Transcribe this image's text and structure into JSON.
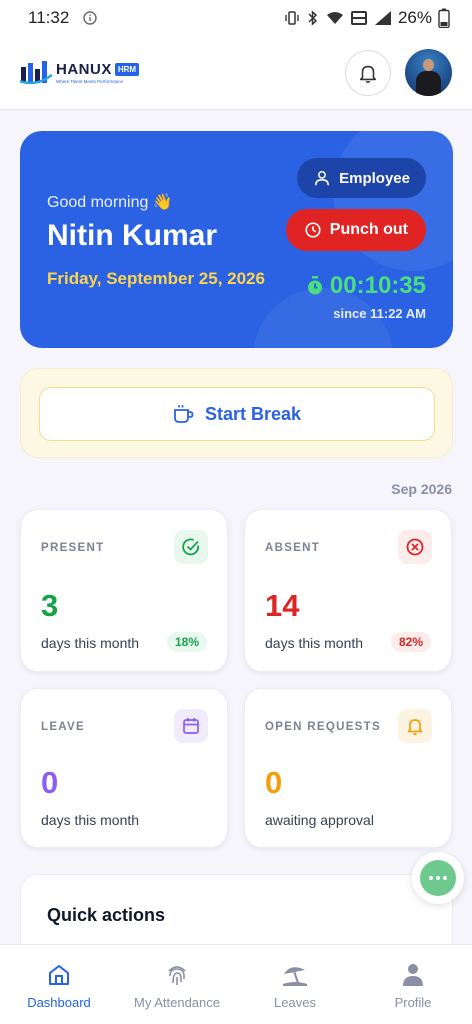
{
  "status_bar": {
    "time": "11:32",
    "battery": "26%"
  },
  "header": {
    "logo_word": "HANUX",
    "logo_badge": "HRM",
    "logo_tagline": "Where Talent Meets Performance"
  },
  "hero": {
    "greeting": "Good morning 👋",
    "name": "Nitin Kumar",
    "date": "Friday, September 25, 2026",
    "role_label": "Employee",
    "punch_label": "Punch out",
    "timer": "00:10:35",
    "since": "since 11:22 AM",
    "colors": {
      "card": "#2a62e3",
      "punch": "#e02424",
      "timer": "#4ade80",
      "date": "#fcd34d"
    }
  },
  "break": {
    "label": "Start Break"
  },
  "month_label": "Sep 2026",
  "stats": {
    "present": {
      "title": "PRESENT",
      "value": "3",
      "sub": "days this month",
      "pct": "18%",
      "color": "#16a34a",
      "icon": "check-circle-icon"
    },
    "absent": {
      "title": "ABSENT",
      "value": "14",
      "sub": "days this month",
      "pct": "82%",
      "color": "#dc2626",
      "icon": "x-circle-icon"
    },
    "leave": {
      "title": "LEAVE",
      "value": "0",
      "sub": "days this month",
      "color": "#8b5cf6",
      "icon": "calendar-icon"
    },
    "open_requests": {
      "title": "OPEN REQUESTS",
      "value": "0",
      "sub": "awaiting approval",
      "color": "#f59e0b",
      "icon": "bell-icon"
    }
  },
  "quick_actions": {
    "title": "Quick actions"
  },
  "nav": [
    {
      "label": "Dashboard",
      "icon": "home-icon",
      "active": true
    },
    {
      "label": "My Attendance",
      "icon": "fingerprint-icon",
      "active": false
    },
    {
      "label": "Leaves",
      "icon": "beach-umbrella-icon",
      "active": false
    },
    {
      "label": "Profile",
      "icon": "person-icon",
      "active": false
    }
  ]
}
